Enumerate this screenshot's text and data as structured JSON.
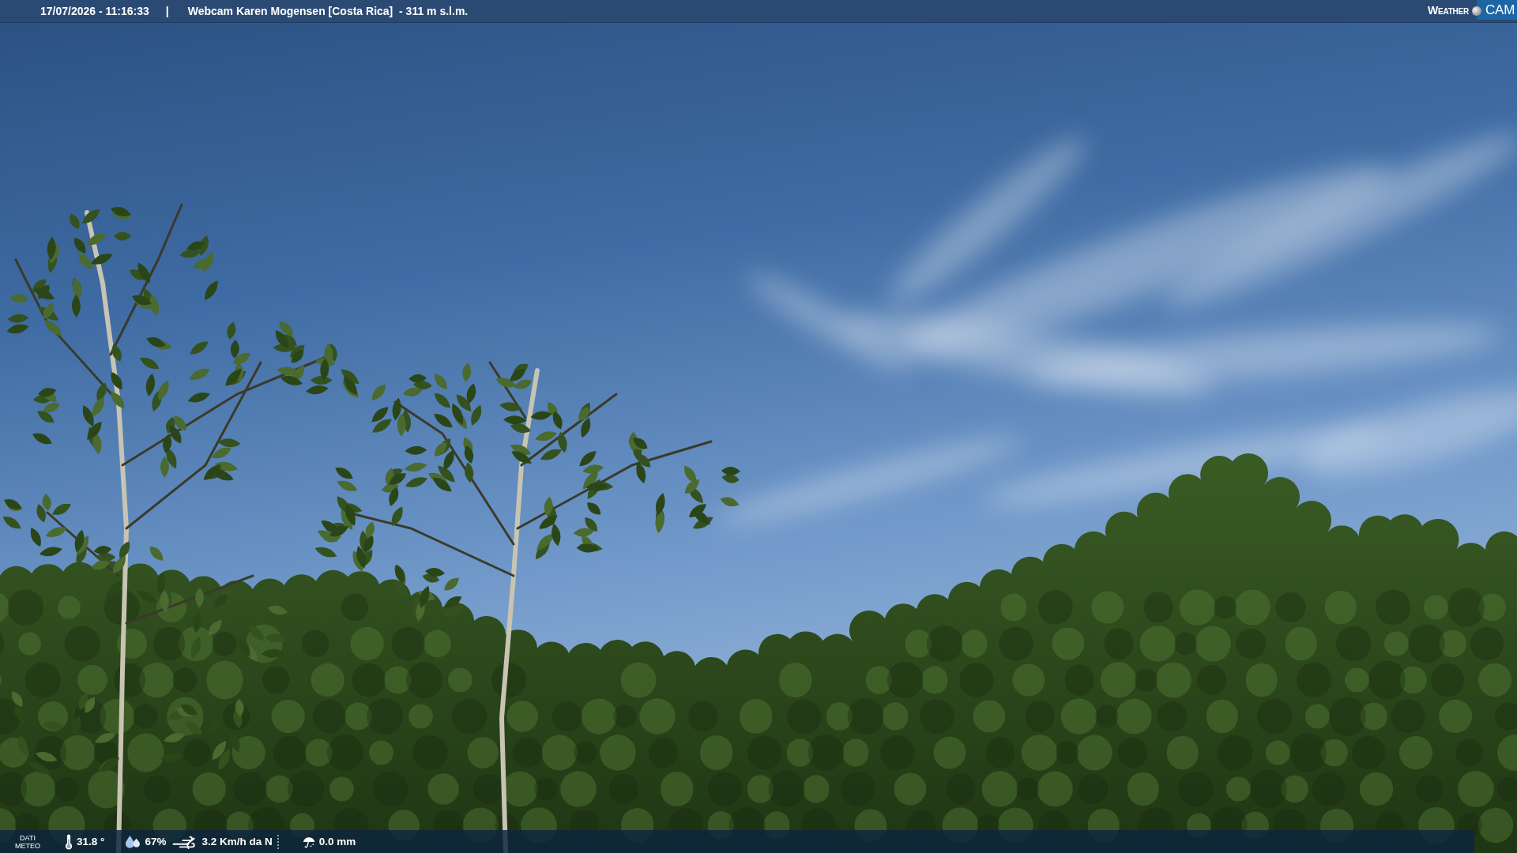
{
  "top_bar": {
    "datetime": "17/07/2026 - 11:16:33",
    "separator": "|",
    "title": "Webcam Karen Mogensen [Costa Rica]  - 311 m s.l.m.",
    "logo": {
      "word": "WEATHER",
      "badge": "CAM"
    }
  },
  "bottom_bar": {
    "label": "DATI METEO",
    "readings": [
      {
        "kind": "temperature",
        "value": "31.8 °"
      },
      {
        "kind": "humidity",
        "value": "67%"
      },
      {
        "kind": "wind",
        "value": "3.2 Km/h da N"
      },
      {
        "kind": "rain",
        "value": "0.0 mm"
      }
    ]
  }
}
